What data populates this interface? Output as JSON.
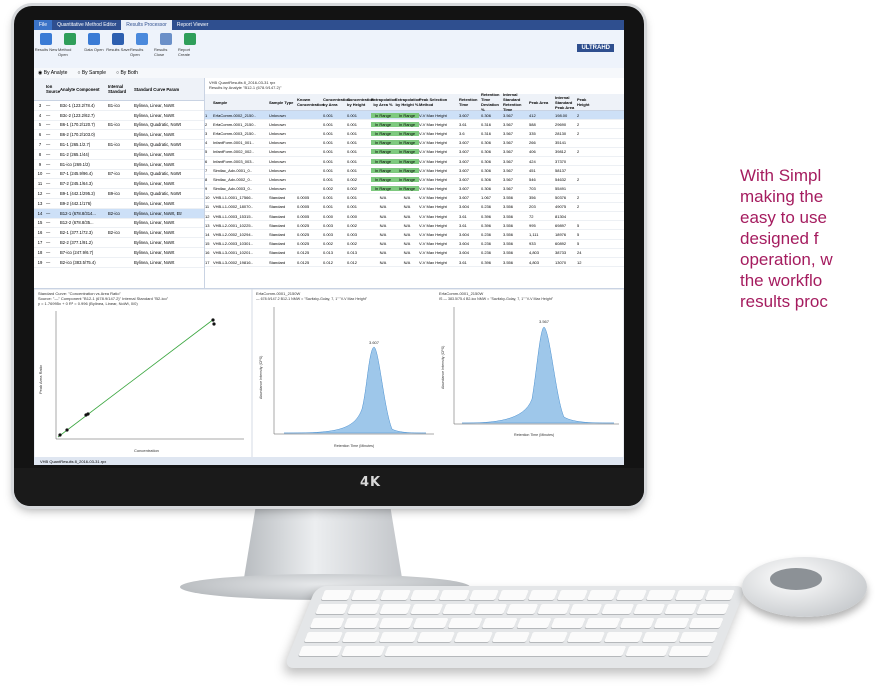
{
  "tagline": {
    "lines": [
      "With Simpl",
      "making the",
      "easy to use",
      "designed f",
      "operation, w",
      "the workflo",
      "results proc"
    ]
  },
  "monitor": {
    "brand": "4K"
  },
  "app": {
    "tabs": [
      "File",
      "Quantitative Method Editor",
      "Results Processor",
      "Report Viewer"
    ],
    "ribbon_buttons": [
      {
        "label": "Results New",
        "color": "#3a7bd5"
      },
      {
        "label": "Method Open",
        "color": "#2f9e5a"
      },
      {
        "label": "Data Open",
        "color": "#3a7bd5"
      },
      {
        "label": "Results Save",
        "color": "#2d5fb0"
      },
      {
        "label": "Results Open",
        "color": "#4a89dc"
      },
      {
        "label": "Results Close",
        "color": "#6a8fc8"
      },
      {
        "label": "Report Create",
        "color": "#2f9e5a"
      }
    ],
    "ultrahd": "ULTRAHD",
    "view_options": [
      "By Analyte",
      "By Sample",
      "By Both"
    ],
    "left_table": {
      "headers": [
        "",
        "Ion Source",
        "Analyte Component",
        "Internal Standard",
        "Standard Curve Param"
      ],
      "rows": [
        [
          "3",
          "—",
          "B3c-1 (123.2/78.4)",
          "B1-ico",
          "Bylinea, Linear, NoWt"
        ],
        [
          "4",
          "—",
          "B3c-2 (123.2/62.7)",
          "",
          "Bylinea, Linear, NoWt"
        ],
        [
          "5",
          "—",
          "B6-1 (170.2/120.7)",
          "B1-ico",
          "Bylinea, Quadratic, NoWt"
        ],
        [
          "6",
          "—",
          "B6-2 (170.2/103.0)",
          "",
          "Bylinea, Linear, NoWt"
        ],
        [
          "7",
          "—",
          "B1-1 (265.1/2.7)",
          "B1-ico",
          "Bylinea, Quadratic, NoWt"
        ],
        [
          "8",
          "—",
          "B1-2 (265.1/44)",
          "",
          "Bylinea, Linear, NoWt"
        ],
        [
          "9",
          "—",
          "B1-ico (269.1/2)",
          "",
          "Bylinea, Linear, NoWt"
        ],
        [
          "10",
          "—",
          "B7-1 (245.9/96.4)",
          "B7-ico",
          "Bylinea, Quadratic, NoWt"
        ],
        [
          "11",
          "—",
          "B7-2 (245.1/64.3)",
          "",
          "Bylinea, Linear, NoWt"
        ],
        [
          "12",
          "—",
          "B9-1 (442.1/295.2)",
          "B9-ico",
          "Bylinea, Quadratic, NoWt"
        ],
        [
          "13",
          "—",
          "B9-2 (442.1/176)",
          "",
          "Bylinea, Linear, NoWt"
        ],
        [
          "14",
          "—",
          "B12-1 (678.8/314...",
          "B2-ico",
          "Bylinea, Linear, NoWt, Etr"
        ],
        [
          "15",
          "—",
          "B12-2 (678.8/35...",
          "",
          "Bylinea, Linear, NoWt"
        ],
        [
          "16",
          "—",
          "B2-1 (377.1/72.3)",
          "B2-ico",
          "Bylinea, Linear, NoWt"
        ],
        [
          "17",
          "—",
          "B2-2 (377.1/91.2)",
          "",
          "Bylinea, Linear, NoWt"
        ],
        [
          "18",
          "—",
          "B7-ico (247.9/6.7)",
          "",
          "Bylinea, Linear, NoWt"
        ],
        [
          "19",
          "—",
          "B2-ico (383.5/75.4)",
          "",
          "Bylinea, Linear, NoWt"
        ]
      ],
      "selected_row": 11
    },
    "grid": {
      "info_line1": "VHB QuantResults 8_2016-03-31 rpx",
      "info_line2": "Results by Analyte \"B12-1 (678.9/147.2)\"",
      "headers": [
        "",
        "Sample",
        "Sample Type",
        "Known Concentration",
        "Concentration by Area",
        "Concentration by Height",
        "Extrapolation by Area %",
        "Extrapolation by Height %",
        "Peak Selection Method",
        "Retention Time",
        "Retention Time Deviation %",
        "Internal Standard Retention Time",
        "Peak Area",
        "Internal Standard Peak Area",
        "Peak Height"
      ],
      "rows": [
        [
          "1",
          "ErfaComm-0002_2150..",
          "Unknown",
          "",
          "0.001",
          "0.001",
          "In Range",
          "In Range",
          "V-V Max Height",
          "3.607",
          "0.306",
          "3.567",
          "412",
          "198.00",
          "2"
        ],
        [
          "2",
          "ErfaComm-0001_2150..",
          "Unknown",
          "",
          "0.001",
          "0.001",
          "In Range",
          "In Range",
          "V-V Max Height",
          "3.61",
          "0.316",
          "3.567",
          "588",
          "29690",
          "2"
        ],
        [
          "3",
          "ErfaComm-0003_2150..",
          "Unknown",
          "",
          "0.001",
          "0.001",
          "In Range",
          "In Range",
          "V-V Max Height",
          "3.6",
          "0.316",
          "3.567",
          "335",
          "28130",
          "2"
        ],
        [
          "4",
          "InfantForm-0001_001..",
          "Unknown",
          "",
          "0.001",
          "0.001",
          "In Range",
          "In Range",
          "V-V Max Height",
          "3.607",
          "0.306",
          "3.567",
          "266",
          "35141",
          ""
        ],
        [
          "5",
          "InfantForm-0002_002..",
          "Unknown",
          "",
          "0.001",
          "0.001",
          "In Range",
          "In Range",
          "V-V Max Height",
          "3.607",
          "0.306",
          "3.567",
          "406",
          "39812",
          "2"
        ],
        [
          "6",
          "InfantForm-0003_003..",
          "Unknown",
          "",
          "0.001",
          "0.001",
          "In Range",
          "In Range",
          "V-V Max Height",
          "3.607",
          "0.306",
          "3.567",
          "424",
          "37370",
          ""
        ],
        [
          "7",
          "Similac_Adv-0001_0..",
          "Unknown",
          "",
          "0.001",
          "0.001",
          "In Range",
          "In Range",
          "V-V Max Height",
          "3.607",
          "0.306",
          "3.567",
          "451",
          "58137",
          ""
        ],
        [
          "8",
          "Similac_Adv-0002_0..",
          "Unknown",
          "",
          "0.001",
          "0.002",
          "In Range",
          "In Range",
          "V-V Max Height",
          "3.607",
          "0.306",
          "3.567",
          "546",
          "54632",
          "2"
        ],
        [
          "9",
          "Similac_Adv-0003_0..",
          "Unknown",
          "",
          "0.002",
          "0.002",
          "In Range",
          "In Range",
          "V-V Max Height",
          "3.607",
          "0.306",
          "3.567",
          "703",
          "55491",
          ""
        ],
        [
          "10",
          "VHB-L1-0001_17566..",
          "Standard",
          "0.0005",
          "0.001",
          "0.001",
          "N/A",
          "N/A",
          "V-V Max Height",
          "3.607",
          "1.067",
          "3.556",
          "356",
          "50376",
          "2"
        ],
        [
          "11",
          "VHB-L1-0002_18070..",
          "Standard",
          "0.0005",
          "0.001",
          "0.001",
          "N/A",
          "N/A",
          "V-V Max Height",
          "3.604",
          "0.236",
          "3.556",
          "203",
          "49075",
          "2"
        ],
        [
          "12",
          "VHB-L1-0003_15315..",
          "Standard",
          "0.0005",
          "0.000",
          "0.000",
          "N/A",
          "N/A",
          "V-V Max Height",
          "3.61",
          "0.396",
          "3.556",
          "72",
          "81304",
          ""
        ],
        [
          "13",
          "VHB-L2-0001_10225..",
          "Standard",
          "0.0025",
          "0.003",
          "0.002",
          "N/A",
          "N/A",
          "V-V Max Height",
          "3.61",
          "0.396",
          "3.556",
          "995",
          "69897",
          "5"
        ],
        [
          "14",
          "VHB-L2-0002_10294..",
          "Standard",
          "0.0025",
          "0.003",
          "0.003",
          "N/A",
          "N/A",
          "V-V Max Height",
          "3.604",
          "0.236",
          "3.556",
          "1,111",
          "18976",
          "5"
        ],
        [
          "15",
          "VHB-L2-0003_10301..",
          "Standard",
          "0.0025",
          "0.002",
          "0.002",
          "N/A",
          "N/A",
          "V-V Max Height",
          "3.604",
          "0.236",
          "3.556",
          "933",
          "60892",
          "5"
        ],
        [
          "16",
          "VHB-L3-0001_10201..",
          "Standard",
          "0.0125",
          "0.013",
          "0.013",
          "N/A",
          "N/A",
          "V-V Max Height",
          "3.604",
          "0.236",
          "3.556",
          "4,803",
          "38733",
          "24"
        ],
        [
          "17",
          "VHB-L3-0002_19816..",
          "Standard",
          "0.0125",
          "0.012",
          "0.012",
          "N/A",
          "N/A",
          "V-V Max Height",
          "3.61",
          "0.396",
          "3.556",
          "4,803",
          "13070",
          "12"
        ]
      ],
      "selected_row": 0
    },
    "curve_panel": {
      "title": "Standard Curve: \"Concentration vs Area Ratio\"",
      "line2": "Source: \"—\" Component \"B12-1 (678.9/147.2)\" Internal Standard \"B2-ico\"",
      "line3": "y = 1.76995x + 0   R² = 0.996  (Bylinea, Linear, NoWt, 0/0)",
      "ylabel": "Peak Area Ratio",
      "xlabel": "Concentration"
    },
    "chrom1": {
      "title": "ErfaComm-0001_2150W",
      "line2": "— 678.9/147.2 B12-1 NMW = \"Savitzky-Golay, 7, 1\" \"V-V Max Height\"",
      "peak_label": "3.607",
      "ylabel": "Abundance Intensity (CPS)",
      "xlabel": "Retention Time (Minutes)"
    },
    "chrom2": {
      "title": "ErfaComm-0001_2150W",
      "line2": "IS — 383.5/75.4 B2-ico NMW = \"Savitzky-Golay, 7, 1\" \"V-V Max Height\"",
      "peak_label": "3.567",
      "ylabel": "Abundance Intensity (CPS)",
      "xlabel": "Retention Time (Minutes)"
    },
    "taskbar_label": "VHB QuantResults 8_2016-03-31.rpx"
  }
}
